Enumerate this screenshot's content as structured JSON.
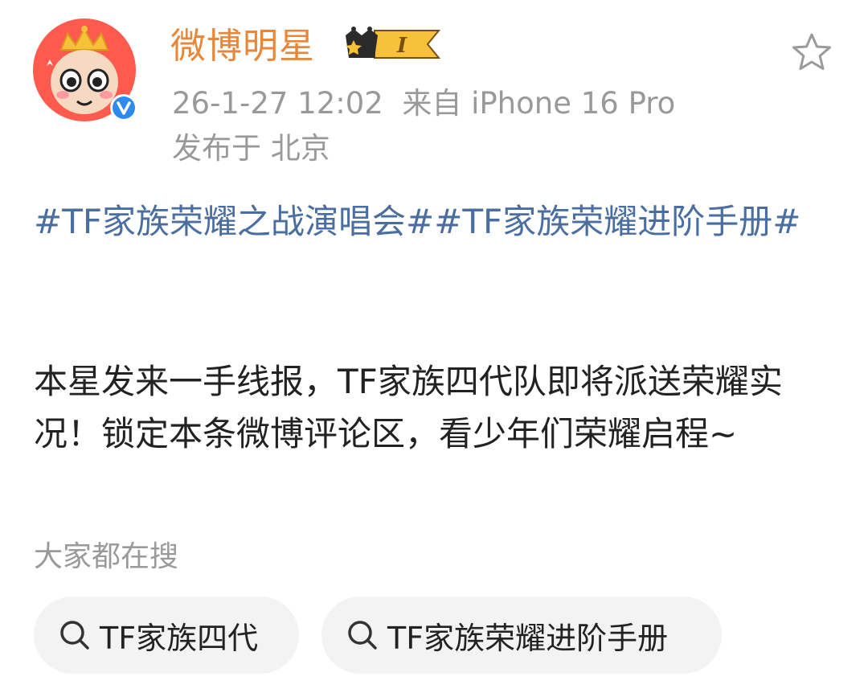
{
  "post": {
    "author": {
      "name": "微博明星",
      "avatar_icon": "cartoon-mascot-avatar",
      "verified_icon": "verified-v-icon",
      "vip_level": "I"
    },
    "meta": {
      "time_source": "26-1-27 12:02  来自 iPhone 16 Pro",
      "location": "发布于 北京"
    },
    "hashtags": [
      "#TF家族荣耀之战演唱会#",
      "#TF家族荣耀进阶手册#"
    ],
    "body": "本星发来一手线报，TF家族四代队即将派送荣耀实况！锁定本条微博评论区，看少年们荣耀启程~",
    "favorite_icon": "star-outline-icon"
  },
  "search_section": {
    "label": "大家都在搜",
    "suggestions": [
      {
        "text": "TF家族四代"
      },
      {
        "text": "TF家族荣耀进阶手册"
      }
    ]
  },
  "colors": {
    "author_name": "#e8863a",
    "hashtag": "#4a6ea0",
    "meta": "#999999",
    "chip_bg": "#f3f3f3"
  }
}
